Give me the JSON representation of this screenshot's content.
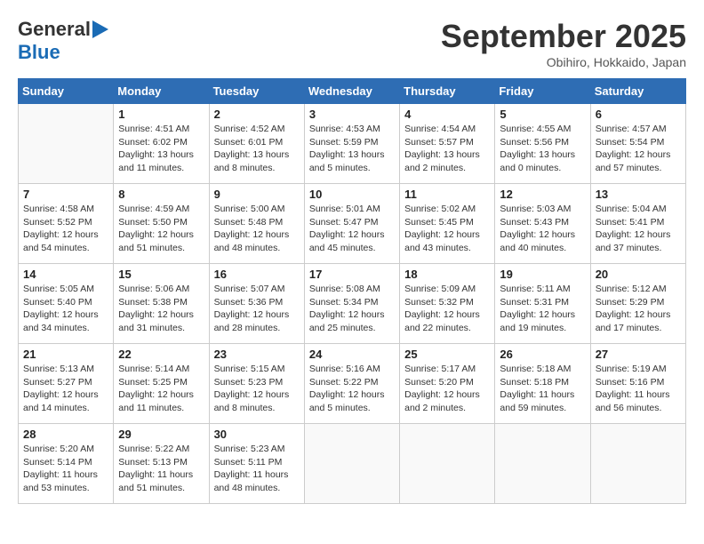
{
  "header": {
    "logo_line1": "General",
    "logo_line2": "Blue",
    "month": "September 2025",
    "location": "Obihiro, Hokkaido, Japan"
  },
  "weekdays": [
    "Sunday",
    "Monday",
    "Tuesday",
    "Wednesday",
    "Thursday",
    "Friday",
    "Saturday"
  ],
  "weeks": [
    [
      {
        "day": "",
        "info": ""
      },
      {
        "day": "1",
        "info": "Sunrise: 4:51 AM\nSunset: 6:02 PM\nDaylight: 13 hours\nand 11 minutes."
      },
      {
        "day": "2",
        "info": "Sunrise: 4:52 AM\nSunset: 6:01 PM\nDaylight: 13 hours\nand 8 minutes."
      },
      {
        "day": "3",
        "info": "Sunrise: 4:53 AM\nSunset: 5:59 PM\nDaylight: 13 hours\nand 5 minutes."
      },
      {
        "day": "4",
        "info": "Sunrise: 4:54 AM\nSunset: 5:57 PM\nDaylight: 13 hours\nand 2 minutes."
      },
      {
        "day": "5",
        "info": "Sunrise: 4:55 AM\nSunset: 5:56 PM\nDaylight: 13 hours\nand 0 minutes."
      },
      {
        "day": "6",
        "info": "Sunrise: 4:57 AM\nSunset: 5:54 PM\nDaylight: 12 hours\nand 57 minutes."
      }
    ],
    [
      {
        "day": "7",
        "info": "Sunrise: 4:58 AM\nSunset: 5:52 PM\nDaylight: 12 hours\nand 54 minutes."
      },
      {
        "day": "8",
        "info": "Sunrise: 4:59 AM\nSunset: 5:50 PM\nDaylight: 12 hours\nand 51 minutes."
      },
      {
        "day": "9",
        "info": "Sunrise: 5:00 AM\nSunset: 5:48 PM\nDaylight: 12 hours\nand 48 minutes."
      },
      {
        "day": "10",
        "info": "Sunrise: 5:01 AM\nSunset: 5:47 PM\nDaylight: 12 hours\nand 45 minutes."
      },
      {
        "day": "11",
        "info": "Sunrise: 5:02 AM\nSunset: 5:45 PM\nDaylight: 12 hours\nand 43 minutes."
      },
      {
        "day": "12",
        "info": "Sunrise: 5:03 AM\nSunset: 5:43 PM\nDaylight: 12 hours\nand 40 minutes."
      },
      {
        "day": "13",
        "info": "Sunrise: 5:04 AM\nSunset: 5:41 PM\nDaylight: 12 hours\nand 37 minutes."
      }
    ],
    [
      {
        "day": "14",
        "info": "Sunrise: 5:05 AM\nSunset: 5:40 PM\nDaylight: 12 hours\nand 34 minutes."
      },
      {
        "day": "15",
        "info": "Sunrise: 5:06 AM\nSunset: 5:38 PM\nDaylight: 12 hours\nand 31 minutes."
      },
      {
        "day": "16",
        "info": "Sunrise: 5:07 AM\nSunset: 5:36 PM\nDaylight: 12 hours\nand 28 minutes."
      },
      {
        "day": "17",
        "info": "Sunrise: 5:08 AM\nSunset: 5:34 PM\nDaylight: 12 hours\nand 25 minutes."
      },
      {
        "day": "18",
        "info": "Sunrise: 5:09 AM\nSunset: 5:32 PM\nDaylight: 12 hours\nand 22 minutes."
      },
      {
        "day": "19",
        "info": "Sunrise: 5:11 AM\nSunset: 5:31 PM\nDaylight: 12 hours\nand 19 minutes."
      },
      {
        "day": "20",
        "info": "Sunrise: 5:12 AM\nSunset: 5:29 PM\nDaylight: 12 hours\nand 17 minutes."
      }
    ],
    [
      {
        "day": "21",
        "info": "Sunrise: 5:13 AM\nSunset: 5:27 PM\nDaylight: 12 hours\nand 14 minutes."
      },
      {
        "day": "22",
        "info": "Sunrise: 5:14 AM\nSunset: 5:25 PM\nDaylight: 12 hours\nand 11 minutes."
      },
      {
        "day": "23",
        "info": "Sunrise: 5:15 AM\nSunset: 5:23 PM\nDaylight: 12 hours\nand 8 minutes."
      },
      {
        "day": "24",
        "info": "Sunrise: 5:16 AM\nSunset: 5:22 PM\nDaylight: 12 hours\nand 5 minutes."
      },
      {
        "day": "25",
        "info": "Sunrise: 5:17 AM\nSunset: 5:20 PM\nDaylight: 12 hours\nand 2 minutes."
      },
      {
        "day": "26",
        "info": "Sunrise: 5:18 AM\nSunset: 5:18 PM\nDaylight: 11 hours\nand 59 minutes."
      },
      {
        "day": "27",
        "info": "Sunrise: 5:19 AM\nSunset: 5:16 PM\nDaylight: 11 hours\nand 56 minutes."
      }
    ],
    [
      {
        "day": "28",
        "info": "Sunrise: 5:20 AM\nSunset: 5:14 PM\nDaylight: 11 hours\nand 53 minutes."
      },
      {
        "day": "29",
        "info": "Sunrise: 5:22 AM\nSunset: 5:13 PM\nDaylight: 11 hours\nand 51 minutes."
      },
      {
        "day": "30",
        "info": "Sunrise: 5:23 AM\nSunset: 5:11 PM\nDaylight: 11 hours\nand 48 minutes."
      },
      {
        "day": "",
        "info": ""
      },
      {
        "day": "",
        "info": ""
      },
      {
        "day": "",
        "info": ""
      },
      {
        "day": "",
        "info": ""
      }
    ]
  ]
}
